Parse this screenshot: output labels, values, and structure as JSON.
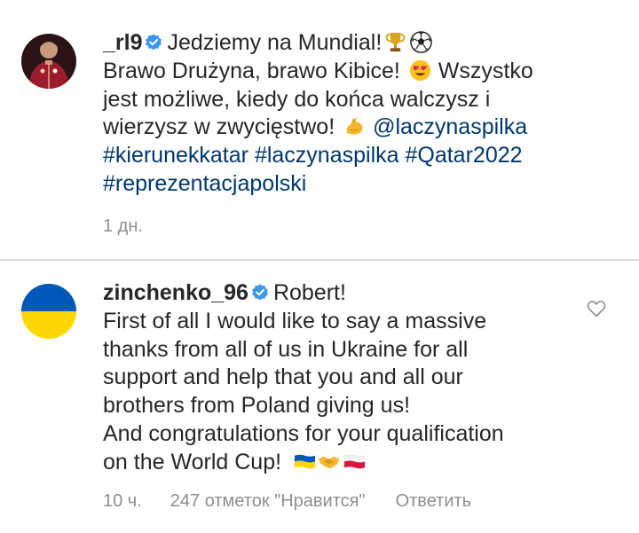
{
  "post": {
    "username": "_rl9",
    "line1": "Jedziemy na Mundial!",
    "line2a": "Brawo Drużyna, brawo Kibice!",
    "line2b": "Wszystko",
    "line3": "jest możliwe, kiedy do końca walczysz i",
    "line4": "wierzysz w zwycięstwo!",
    "mention": "@laczynaspilka",
    "hashtags": [
      "#kierunekkatar",
      "#laczynaspilka",
      "#Qatar2022",
      "#reprezentacjapolski"
    ],
    "time": "1 дн."
  },
  "comment": {
    "username": "zinchenko_96",
    "line1": "Robert!",
    "lines": [
      "First of all I would like to say a massive",
      "thanks from all of us in Ukraine for all",
      "support and help that you and all our",
      "brothers from Poland giving us!",
      "And congratulations for your qualification"
    ],
    "last_line": "on the World Cup!",
    "time": "10 ч.",
    "likes": "247 отметок \"Нравится\"",
    "reply": "Ответить"
  },
  "icons": {
    "verified": "verified-badge-icon",
    "trophy": "trophy-emoji",
    "ball": "soccer-ball-emoji",
    "heart_eyes": "heart-eyes-emoji",
    "muscle": "flexed-biceps-emoji",
    "flag_ua": "ukraine-flag-emoji",
    "handshake": "handshake-emoji",
    "flag_pl": "poland-flag-emoji",
    "like": "heart-outline-icon"
  },
  "colors": {
    "text": "#262626",
    "link": "#00376b",
    "secondary": "#8e8e8e",
    "verified": "#3897f0",
    "ukraine_blue": "#0057b7",
    "ukraine_yellow": "#ffd700"
  }
}
